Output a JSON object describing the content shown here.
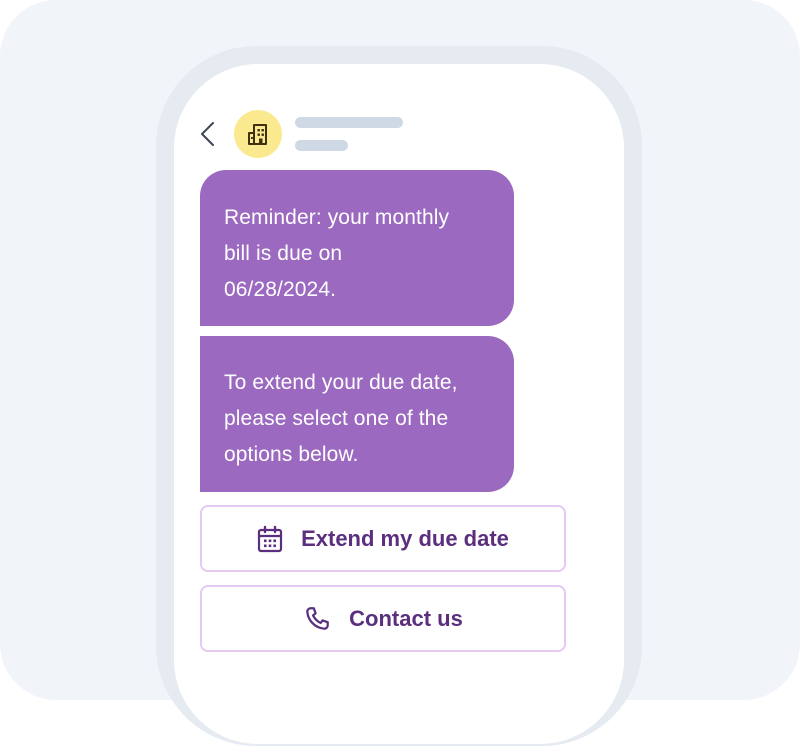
{
  "colors": {
    "background": "#f1f4f8",
    "phone_frame": "#e6ebf2",
    "bubble": "#9b69bf",
    "bubble_text": "#ffffff",
    "avatar_bg": "#fbe98f",
    "button_border": "#e5c9f3",
    "button_text": "#5b2f7e",
    "placeholder_lines": "#cfd9e6"
  },
  "header": {
    "back_icon": "chevron-left-icon",
    "avatar_icon": "building-icon"
  },
  "messages": [
    {
      "lines": [
        "Reminder: your monthly",
        "bill is due on",
        "06/28/2024."
      ]
    },
    {
      "lines": [
        "To extend your due date,",
        "please select one of the",
        "options below."
      ]
    }
  ],
  "actions": [
    {
      "label": "Extend my due date",
      "icon": "calendar-icon"
    },
    {
      "label": "Contact us",
      "icon": "phone-icon"
    }
  ]
}
